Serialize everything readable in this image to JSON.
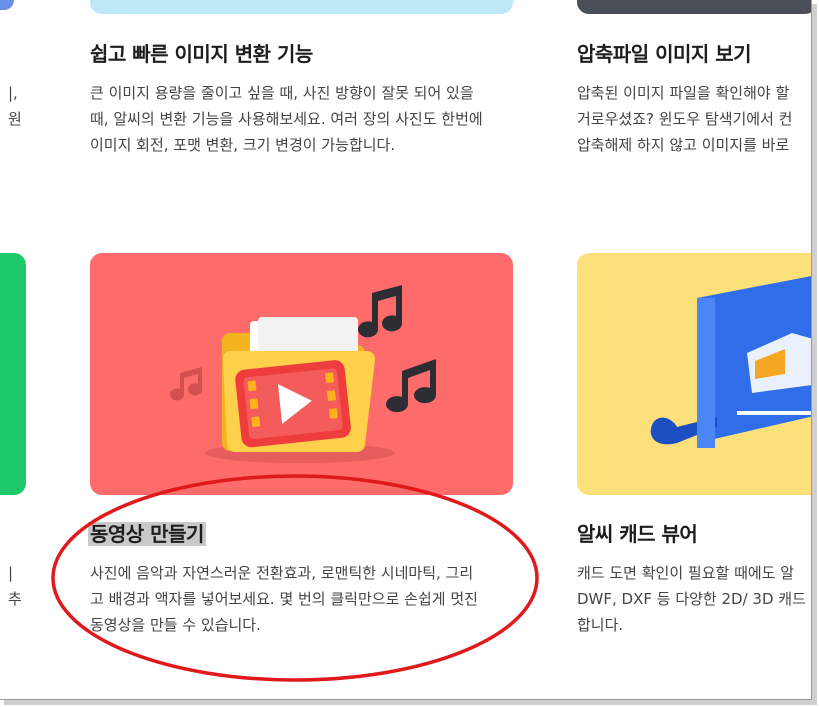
{
  "cards": [
    {
      "title": "쉽고 빠른 이미지 변환 기능",
      "desc_lines": [
        "큰 이미지 용량을 줄이고 싶을 때, 사진 방향이 잘못 되어 있을",
        "때, 알씨의 변환 기능을 사용해보세요. 여러 장의 사진도 한번에",
        "이미지 회전, 포맷 변환, 크기 변경이 가능합니다."
      ]
    },
    {
      "title": "압축파일 이미지 보기",
      "desc_lines": [
        "압축된 이미지 파일을 확인해야 할",
        "거로우셨죠? 윈도우 탐색기에서 컨",
        "압축해제 하지 않고 이미지를 바로"
      ]
    },
    {
      "title": "동영상 만들기",
      "desc_lines": [
        "사진에 음악과 자연스러운 전환효과, 로맨틱한 시네마틱, 그리",
        "고 배경과 액자를 넣어보세요. 몇 번의 클릭만으로 손쉽게 멋진",
        "동영상을 만들 수 있습니다."
      ]
    },
    {
      "title": "알씨 캐드 뷰어",
      "desc_lines": [
        "캐드 도면 확인이 필요할 때에도 알",
        "DWF, DXF 등 다양한 2D/ 3D 캐드",
        "합니다."
      ]
    }
  ],
  "left_fragments": {
    "top": [
      "|,",
      "원"
    ],
    "bottom": [
      "|",
      "추"
    ]
  },
  "colors": {
    "video_card_bg": "#fd6b6b",
    "cad_card_bg": "#fce17a",
    "left_card_green": "#1ec96b",
    "top_bar_blue": "#bde9f6",
    "top_bar_dark": "#4a4f57",
    "annotation_red": "#e0191c"
  }
}
